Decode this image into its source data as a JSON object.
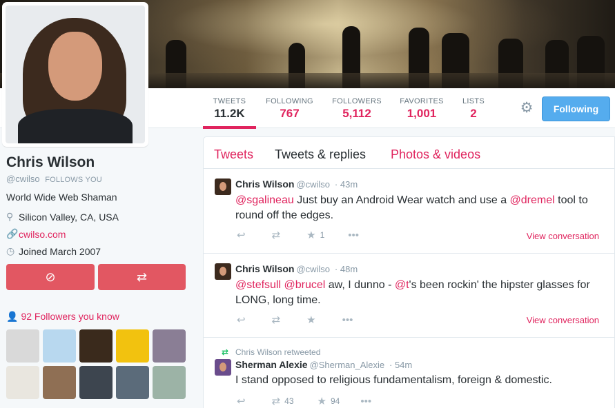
{
  "profile": {
    "name": "Chris Wilson",
    "handle": "@cwilso",
    "follows_you": "FOLLOWS YOU",
    "bio": "World Wide Web Shaman",
    "location": "Silicon Valley, CA, USA",
    "website": "cwilso.com",
    "joined": "Joined March 2007"
  },
  "nav": {
    "stats": [
      {
        "label": "TWEETS",
        "value": "11.2K"
      },
      {
        "label": "FOLLOWING",
        "value": "767"
      },
      {
        "label": "FOLLOWERS",
        "value": "5,112"
      },
      {
        "label": "FAVORITES",
        "value": "1,001"
      },
      {
        "label": "LISTS",
        "value": "2"
      }
    ],
    "follow_button": "Following"
  },
  "followers_you_know": "92 Followers you know",
  "timeline": {
    "tabs": [
      "Tweets",
      "Tweets & replies",
      "Photos & videos"
    ],
    "tweets": [
      {
        "name": "Chris Wilson",
        "handle": "@cwilso",
        "time": "· 43m",
        "mention1": "@sgalineau",
        "text1": " Just buy an Android Wear watch and use a ",
        "mention2": "@dremel",
        "text2": " tool to round off the edges.",
        "favorites": "1",
        "view": "View conversation"
      },
      {
        "name": "Chris Wilson",
        "handle": "@cwilso",
        "time": "· 48m",
        "mention1": "@stefsull",
        "mention2": "@brucel",
        "text1": " aw, I dunno - ",
        "mention3": "@t",
        "text2": "'s been rockin' the hipster glasses for LONG, long time.",
        "view": "View conversation"
      },
      {
        "retweeted_by": "Chris Wilson retweeted",
        "name": "Sherman Alexie",
        "handle": "@Sherman_Alexie",
        "time": "· 54m",
        "text": "I stand opposed to religious fundamentalism, foreign & domestic.",
        "retweets": "43",
        "favorites": "94"
      }
    ]
  },
  "colors": {
    "accent": "#e0245e",
    "follow_button": "#55acee",
    "action_button": "#e25762"
  },
  "icons": [
    "gear-icon",
    "location-pin-icon",
    "link-icon",
    "clock-icon",
    "mute-icon",
    "retweet-icon",
    "person-icon",
    "reply-icon",
    "favorite-star-icon",
    "more-dots-icon"
  ]
}
